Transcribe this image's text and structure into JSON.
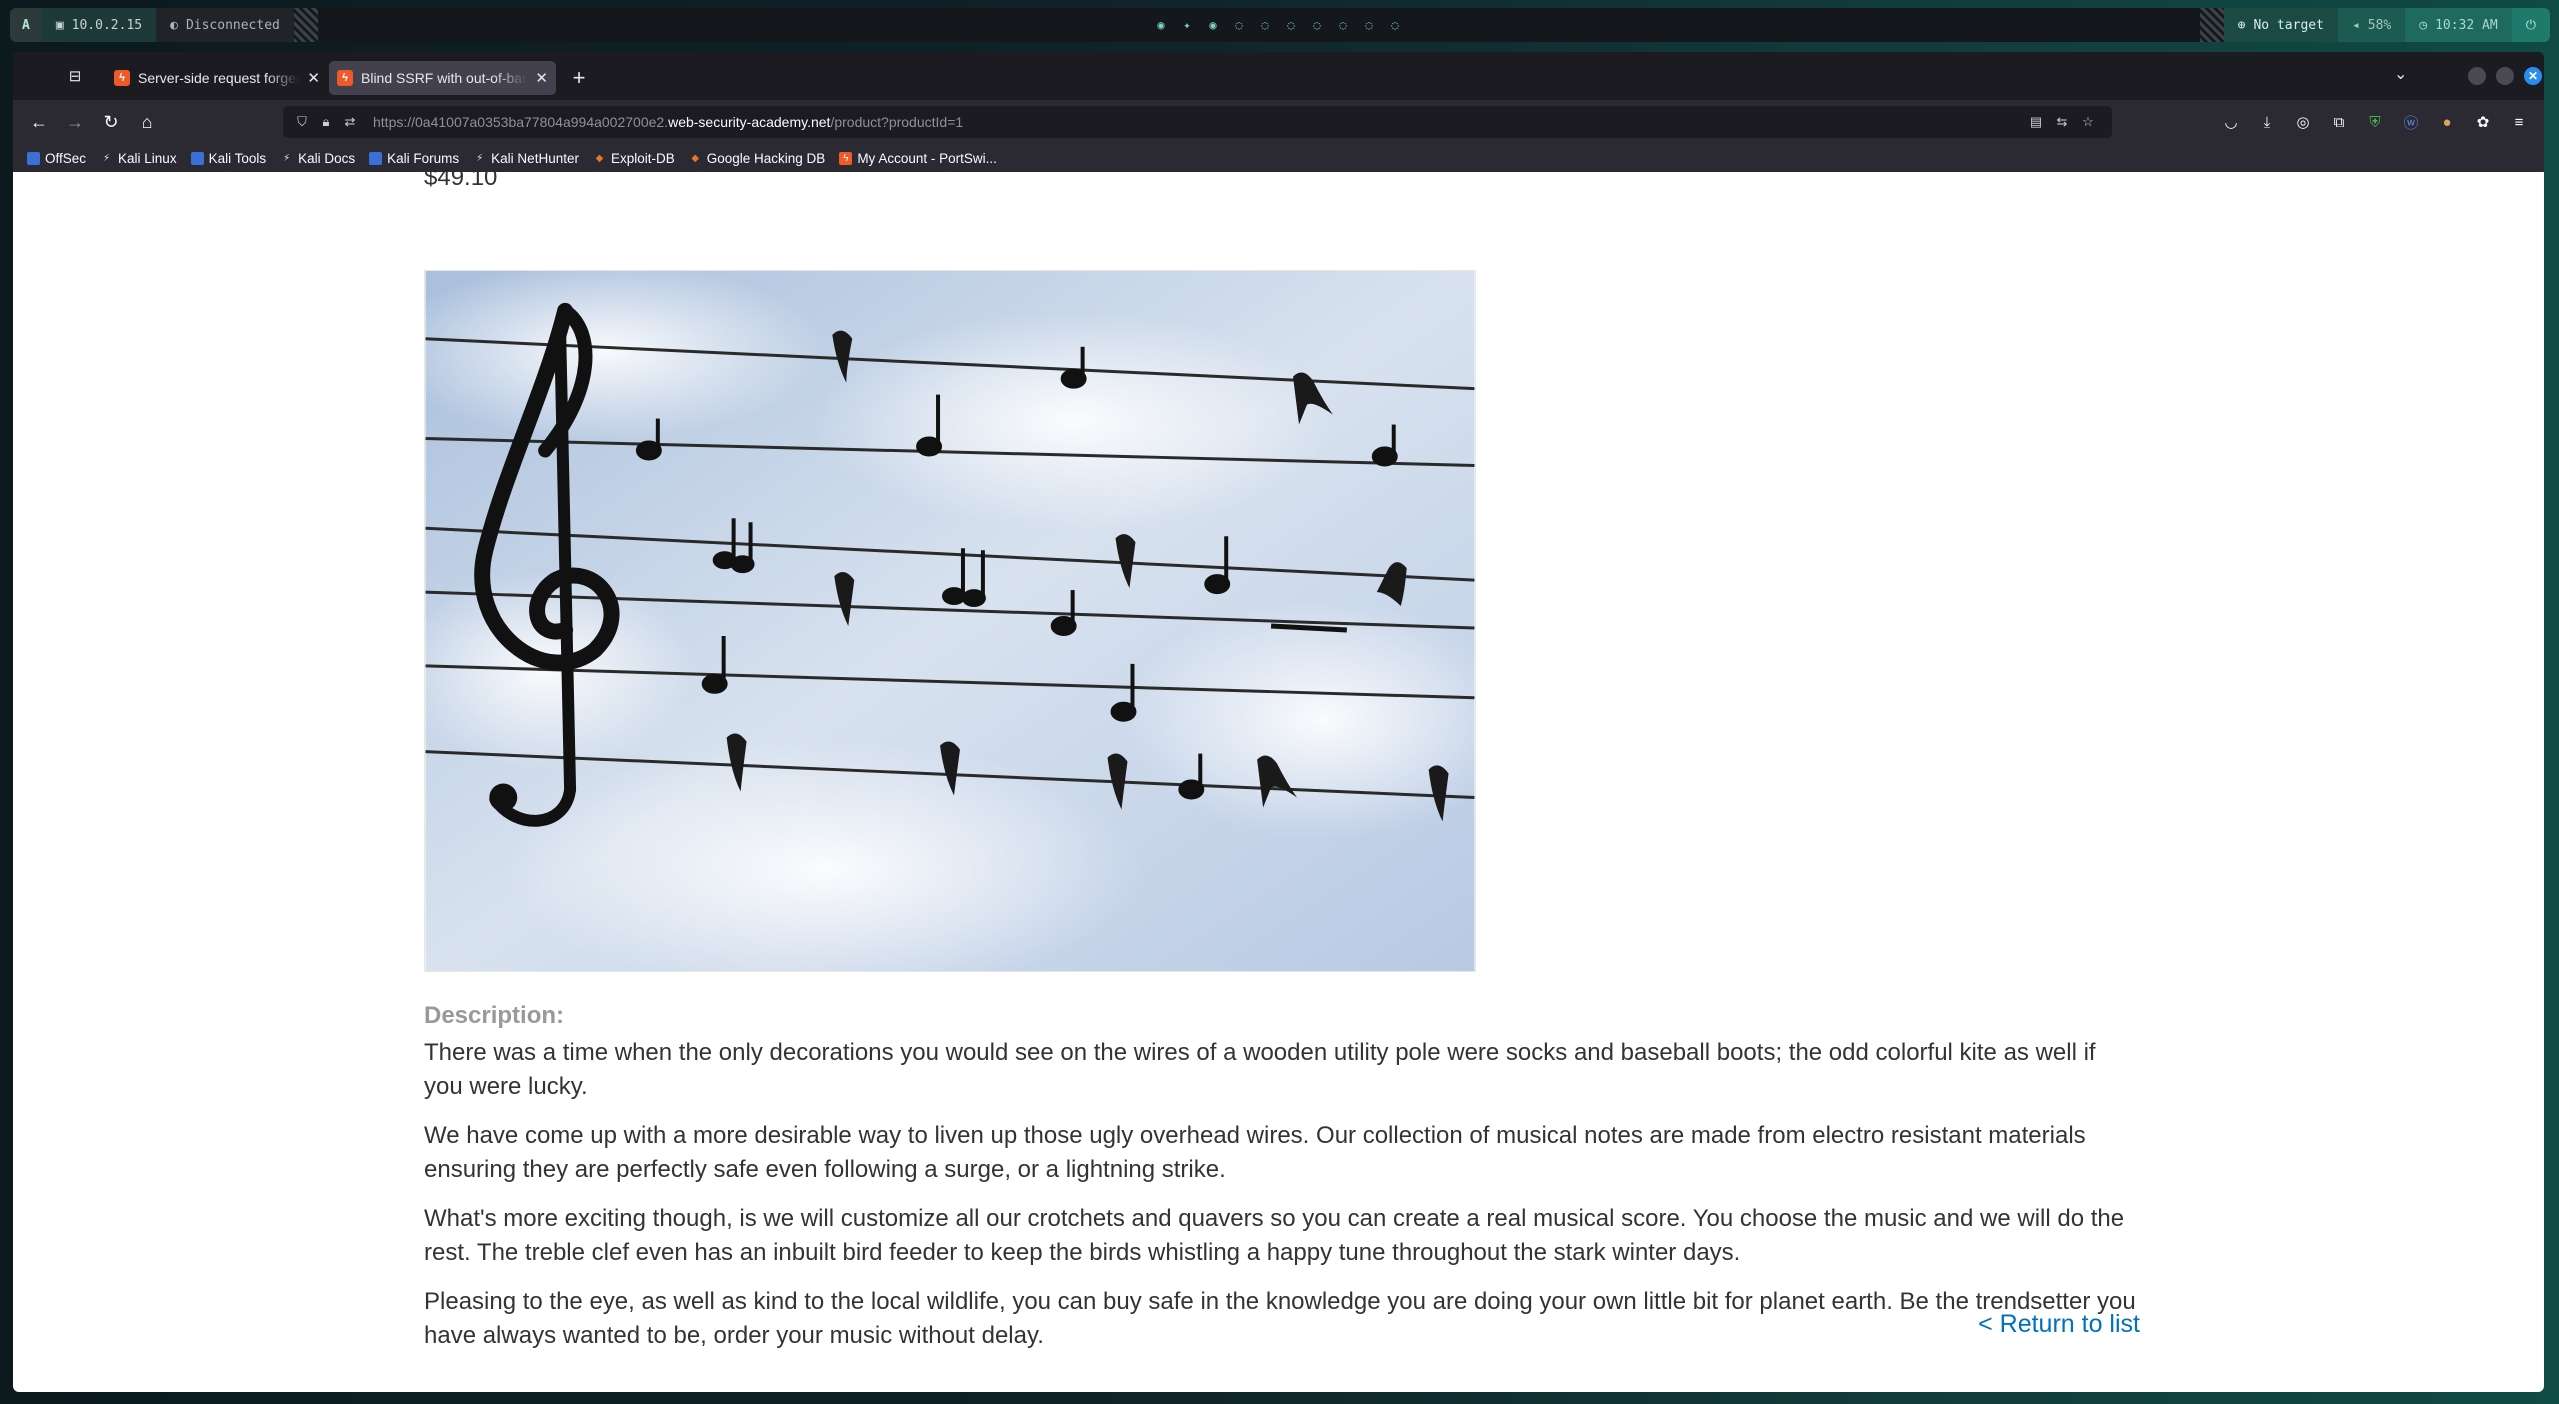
{
  "system_panel": {
    "logo": "A",
    "ip": "10.0.2.15",
    "vpn_status": "Disconnected",
    "target": "No target",
    "battery": "58%",
    "clock": "10:32 AM"
  },
  "browser": {
    "tabs": [
      {
        "title": "Server-side request forgery",
        "active": false
      },
      {
        "title": "Blind SSRF with out-of-band detection",
        "active": true
      }
    ],
    "url": {
      "prefix": "https://0a41007a0353ba77804a994a002700e2.",
      "host": "web-security-academy.net",
      "path": "/product?productId=1"
    },
    "bookmarks": [
      {
        "label": "OffSec",
        "icon": "offsec-icon",
        "color": "#3b6fd8"
      },
      {
        "label": "Kali Linux",
        "icon": "kali-dragon-icon",
        "color": "#e8e8ea"
      },
      {
        "label": "Kali Tools",
        "icon": "kali-tools-icon",
        "color": "#3b6fd8"
      },
      {
        "label": "Kali Docs",
        "icon": "kali-dragon-icon",
        "color": "#e8e8ea"
      },
      {
        "label": "Kali Forums",
        "icon": "kali-forums-icon",
        "color": "#3b6fd8"
      },
      {
        "label": "Kali NetHunter",
        "icon": "kali-dragon-icon",
        "color": "#e8e8ea"
      },
      {
        "label": "Exploit-DB",
        "icon": "exploit-db-icon",
        "color": "#e8732a"
      },
      {
        "label": "Google Hacking DB",
        "icon": "ghdb-icon",
        "color": "#e8732a"
      },
      {
        "label": "My Account - PortSwi...",
        "icon": "portswigger-icon",
        "color": "#f05a28"
      }
    ]
  },
  "product": {
    "price": "$49.10",
    "image_alt": "Treble clef and musical notes on telephone wires with birds",
    "description_label": "Description:",
    "paragraphs": [
      "There was a time when the only decorations you would see on the wires of a wooden utility pole were socks and baseball boots; the odd colorful kite as well if you were lucky.",
      "We have come up with a more desirable way to liven up those ugly overhead wires. Our collection of musical notes are made from electro resistant materials ensuring they are perfectly safe even following a surge, or a lightning strike.",
      "What's more exciting though, is we will customize all our crotchets and quavers so you can create a real musical score. You choose the music and we will do the rest. The treble clef even has an inbuilt bird feeder to keep the birds whistling a happy tune throughout the stark winter days.",
      "Pleasing to the eye, as well as kind to the local wildlife, you can buy safe in the knowledge you are doing your own little bit for planet earth. Be the trendsetter you have always wanted to be, order your music without delay."
    ],
    "return_link": "< Return to list"
  }
}
